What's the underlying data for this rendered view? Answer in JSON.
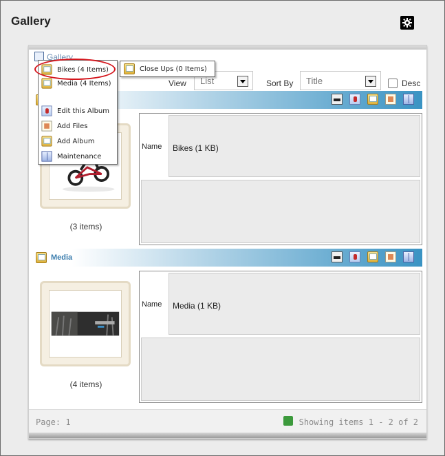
{
  "page": {
    "title": "Gallery"
  },
  "breadcrumb": {
    "label": "Gallery"
  },
  "toolbar": {
    "view_label": "View",
    "view_value": "List",
    "sort_label": "Sort By",
    "sort_value": "Title",
    "desc_label": "Desc",
    "desc_checked": false
  },
  "dropdown": {
    "items": [
      {
        "label": "Bikes (4 Items)",
        "icon": "folder-icon"
      },
      {
        "label": "Media (4 Items)",
        "icon": "folder-icon"
      },
      {
        "label": "Edit this Album",
        "icon": "edit-album-icon"
      },
      {
        "label": "Add Files",
        "icon": "add-files-icon"
      },
      {
        "label": "Add Album",
        "icon": "folder-icon"
      },
      {
        "label": "Maintenance",
        "icon": "book-icon"
      }
    ],
    "submenu": {
      "label": "Close Ups (0 Items)",
      "icon": "folder-icon"
    },
    "highlight_color": "#d4151c"
  },
  "albums": [
    {
      "title": "",
      "count": "(3 items)",
      "name_label": "Name",
      "name_value": "Bikes (1 KB)"
    },
    {
      "title": "Media",
      "count": "(4 items)",
      "name_label": "Name",
      "name_value": "Media (1 KB)"
    }
  ],
  "footer": {
    "page": "Page: 1",
    "showing": "Showing items 1 - 2 of 2"
  },
  "colors": {
    "header_gradient_end": "#3a93c3",
    "album_title": "#3a7cad",
    "panel_bg": "#ebebeb"
  }
}
